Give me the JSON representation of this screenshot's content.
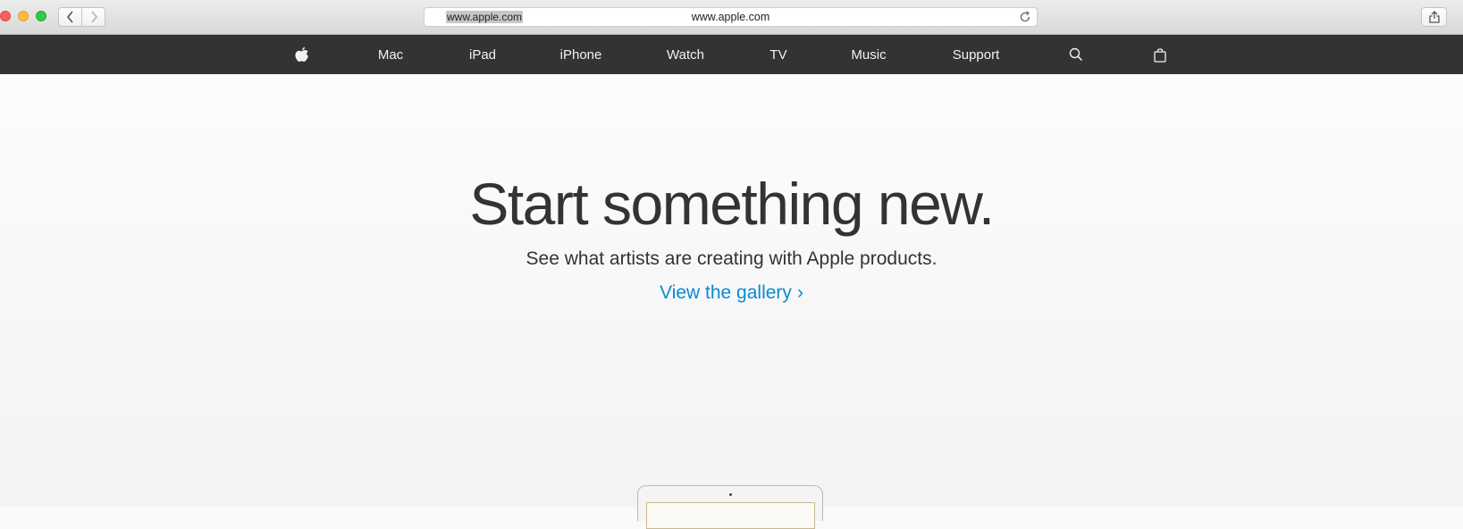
{
  "browser": {
    "url_selected": "www.apple.com",
    "url_display": "www.apple.com",
    "icons": {
      "back": "chevron-left-icon",
      "forward": "chevron-right-icon",
      "reload": "reload-icon",
      "share": "share-icon"
    }
  },
  "globalnav": {
    "background": "#333333",
    "apple_logo": "apple-logo-icon",
    "items": [
      {
        "label": "Mac"
      },
      {
        "label": "iPad"
      },
      {
        "label": "iPhone"
      },
      {
        "label": "Watch"
      },
      {
        "label": "TV"
      },
      {
        "label": "Music"
      },
      {
        "label": "Support"
      }
    ],
    "search_icon": "search-icon",
    "bag_icon": "bag-icon"
  },
  "hero": {
    "headline": "Start something new.",
    "subhead": "See what artists are creating with Apple products.",
    "link": "View the gallery",
    "link_chevron": "›",
    "link_color": "#0a8ad0",
    "device_image": "ipad-image"
  }
}
